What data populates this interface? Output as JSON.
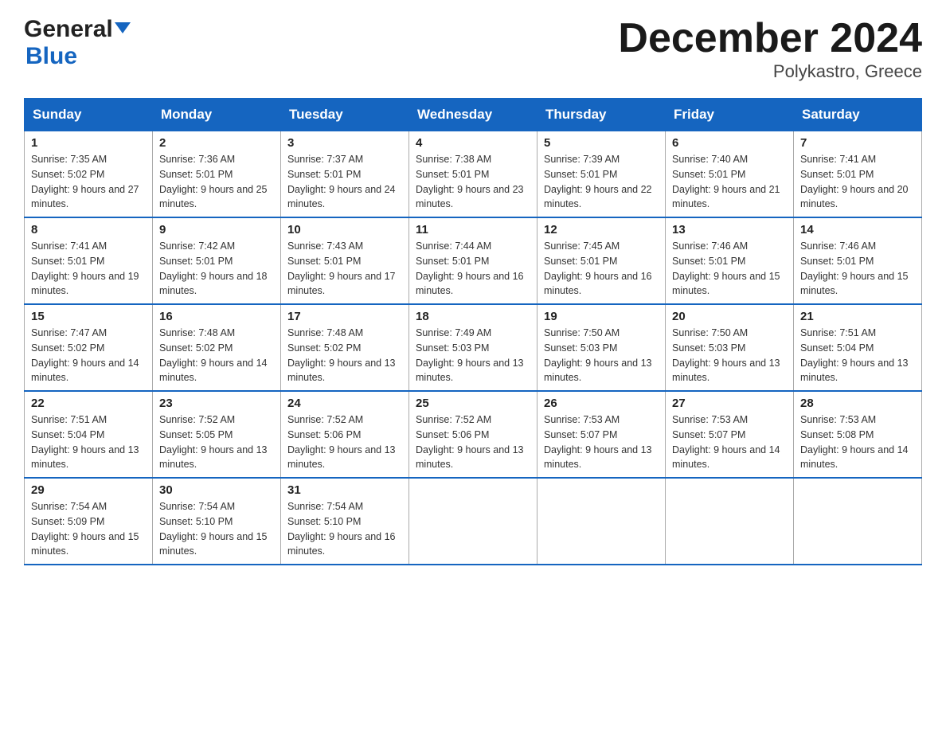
{
  "header": {
    "logo_general": "General",
    "logo_blue": "Blue",
    "month_title": "December 2024",
    "location": "Polykastro, Greece"
  },
  "weekdays": [
    "Sunday",
    "Monday",
    "Tuesday",
    "Wednesday",
    "Thursday",
    "Friday",
    "Saturday"
  ],
  "weeks": [
    [
      {
        "day": "1",
        "sunrise": "7:35 AM",
        "sunset": "5:02 PM",
        "daylight": "9 hours and 27 minutes."
      },
      {
        "day": "2",
        "sunrise": "7:36 AM",
        "sunset": "5:01 PM",
        "daylight": "9 hours and 25 minutes."
      },
      {
        "day": "3",
        "sunrise": "7:37 AM",
        "sunset": "5:01 PM",
        "daylight": "9 hours and 24 minutes."
      },
      {
        "day": "4",
        "sunrise": "7:38 AM",
        "sunset": "5:01 PM",
        "daylight": "9 hours and 23 minutes."
      },
      {
        "day": "5",
        "sunrise": "7:39 AM",
        "sunset": "5:01 PM",
        "daylight": "9 hours and 22 minutes."
      },
      {
        "day": "6",
        "sunrise": "7:40 AM",
        "sunset": "5:01 PM",
        "daylight": "9 hours and 21 minutes."
      },
      {
        "day": "7",
        "sunrise": "7:41 AM",
        "sunset": "5:01 PM",
        "daylight": "9 hours and 20 minutes."
      }
    ],
    [
      {
        "day": "8",
        "sunrise": "7:41 AM",
        "sunset": "5:01 PM",
        "daylight": "9 hours and 19 minutes."
      },
      {
        "day": "9",
        "sunrise": "7:42 AM",
        "sunset": "5:01 PM",
        "daylight": "9 hours and 18 minutes."
      },
      {
        "day": "10",
        "sunrise": "7:43 AM",
        "sunset": "5:01 PM",
        "daylight": "9 hours and 17 minutes."
      },
      {
        "day": "11",
        "sunrise": "7:44 AM",
        "sunset": "5:01 PM",
        "daylight": "9 hours and 16 minutes."
      },
      {
        "day": "12",
        "sunrise": "7:45 AM",
        "sunset": "5:01 PM",
        "daylight": "9 hours and 16 minutes."
      },
      {
        "day": "13",
        "sunrise": "7:46 AM",
        "sunset": "5:01 PM",
        "daylight": "9 hours and 15 minutes."
      },
      {
        "day": "14",
        "sunrise": "7:46 AM",
        "sunset": "5:01 PM",
        "daylight": "9 hours and 15 minutes."
      }
    ],
    [
      {
        "day": "15",
        "sunrise": "7:47 AM",
        "sunset": "5:02 PM",
        "daylight": "9 hours and 14 minutes."
      },
      {
        "day": "16",
        "sunrise": "7:48 AM",
        "sunset": "5:02 PM",
        "daylight": "9 hours and 14 minutes."
      },
      {
        "day": "17",
        "sunrise": "7:48 AM",
        "sunset": "5:02 PM",
        "daylight": "9 hours and 13 minutes."
      },
      {
        "day": "18",
        "sunrise": "7:49 AM",
        "sunset": "5:03 PM",
        "daylight": "9 hours and 13 minutes."
      },
      {
        "day": "19",
        "sunrise": "7:50 AM",
        "sunset": "5:03 PM",
        "daylight": "9 hours and 13 minutes."
      },
      {
        "day": "20",
        "sunrise": "7:50 AM",
        "sunset": "5:03 PM",
        "daylight": "9 hours and 13 minutes."
      },
      {
        "day": "21",
        "sunrise": "7:51 AM",
        "sunset": "5:04 PM",
        "daylight": "9 hours and 13 minutes."
      }
    ],
    [
      {
        "day": "22",
        "sunrise": "7:51 AM",
        "sunset": "5:04 PM",
        "daylight": "9 hours and 13 minutes."
      },
      {
        "day": "23",
        "sunrise": "7:52 AM",
        "sunset": "5:05 PM",
        "daylight": "9 hours and 13 minutes."
      },
      {
        "day": "24",
        "sunrise": "7:52 AM",
        "sunset": "5:06 PM",
        "daylight": "9 hours and 13 minutes."
      },
      {
        "day": "25",
        "sunrise": "7:52 AM",
        "sunset": "5:06 PM",
        "daylight": "9 hours and 13 minutes."
      },
      {
        "day": "26",
        "sunrise": "7:53 AM",
        "sunset": "5:07 PM",
        "daylight": "9 hours and 13 minutes."
      },
      {
        "day": "27",
        "sunrise": "7:53 AM",
        "sunset": "5:07 PM",
        "daylight": "9 hours and 14 minutes."
      },
      {
        "day": "28",
        "sunrise": "7:53 AM",
        "sunset": "5:08 PM",
        "daylight": "9 hours and 14 minutes."
      }
    ],
    [
      {
        "day": "29",
        "sunrise": "7:54 AM",
        "sunset": "5:09 PM",
        "daylight": "9 hours and 15 minutes."
      },
      {
        "day": "30",
        "sunrise": "7:54 AM",
        "sunset": "5:10 PM",
        "daylight": "9 hours and 15 minutes."
      },
      {
        "day": "31",
        "sunrise": "7:54 AM",
        "sunset": "5:10 PM",
        "daylight": "9 hours and 16 minutes."
      },
      null,
      null,
      null,
      null
    ]
  ]
}
